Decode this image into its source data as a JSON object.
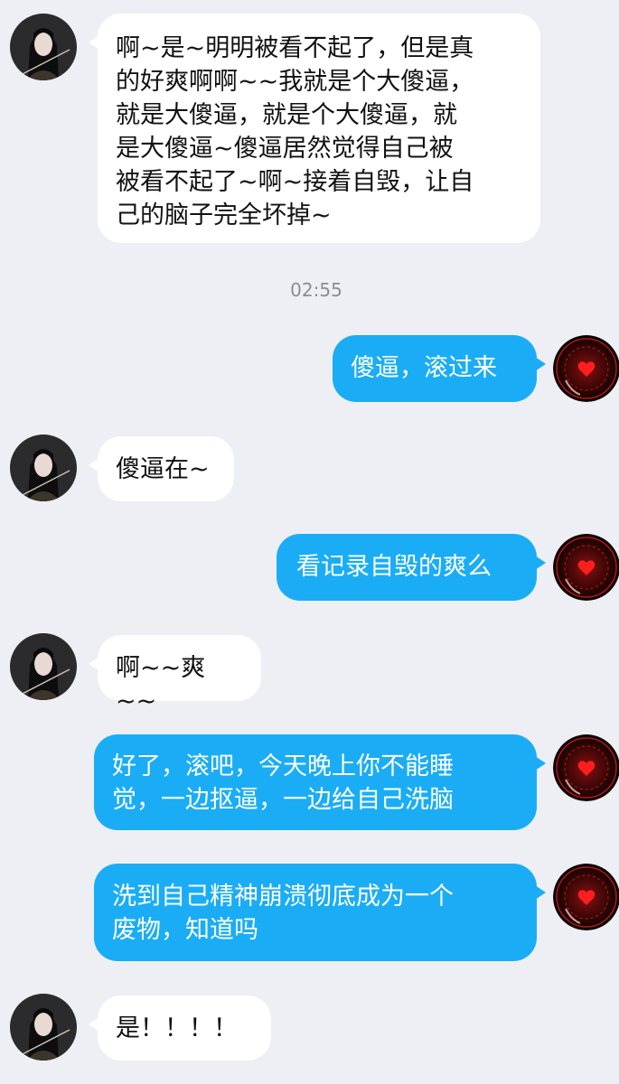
{
  "messages": [
    {
      "id": 1,
      "side": "left",
      "lines": [
        "啊~是~明明被看不起了，但是真",
        "的好爽啊啊~~我就是个大傻逼，",
        "就是大傻逼，就是个大傻逼，就",
        "是大傻逼~傻逼居然觉得自己被",
        "被看不起了~啊~接着自毁，让自",
        "己的脑子完全坏掉~"
      ]
    },
    {
      "id": 2,
      "side": "right",
      "lines": [
        "傻逼，滚过来"
      ]
    },
    {
      "id": 3,
      "side": "left",
      "lines": [
        "傻逼在~"
      ]
    },
    {
      "id": 4,
      "side": "right",
      "lines": [
        "看记录自毁的爽么"
      ]
    },
    {
      "id": 5,
      "side": "left",
      "lines": [
        "啊~~爽~~"
      ]
    },
    {
      "id": 6,
      "side": "right",
      "lines": [
        "好了，滚吧，今天晚上你不能睡",
        "觉，一边抠逼，一边给自己洗脑"
      ]
    },
    {
      "id": 7,
      "side": "right",
      "lines": [
        "洗到自己精神崩溃彻底成为一个",
        "废物，知道吗"
      ]
    },
    {
      "id": 8,
      "side": "left",
      "lines": [
        "是！！！！"
      ]
    }
  ],
  "timestamp": "02:55",
  "colors": {
    "background": "#eeeff4",
    "incoming_bubble": "#ffffff",
    "outgoing_bubble": "#1aadf5"
  }
}
